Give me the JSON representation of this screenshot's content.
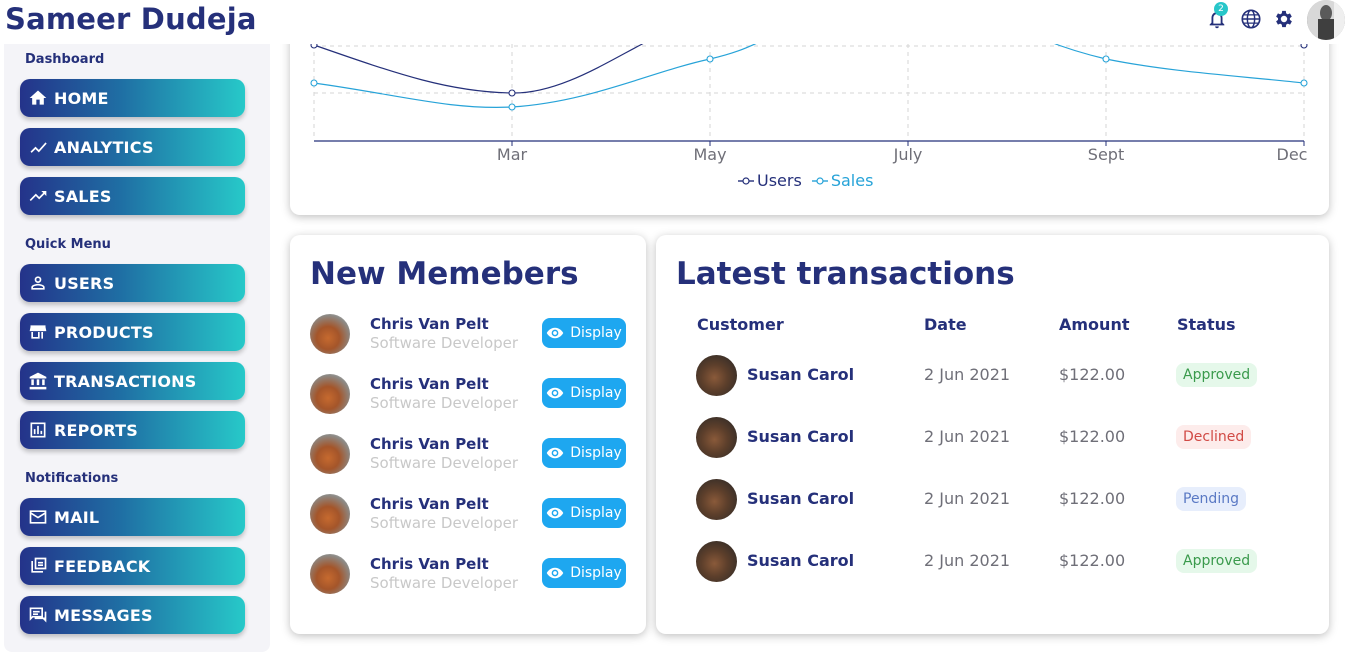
{
  "header": {
    "title": "Sameer Dudeja",
    "notification_count": "2"
  },
  "sidebar": {
    "sections": [
      {
        "title": "Dashboard",
        "items": [
          {
            "label": "HOME",
            "icon": "home-icon"
          },
          {
            "label": "ANALYTICS",
            "icon": "line-chart-icon"
          },
          {
            "label": "SALES",
            "icon": "trending-up-icon"
          }
        ]
      },
      {
        "title": "Quick Menu",
        "items": [
          {
            "label": "USERS",
            "icon": "person-icon"
          },
          {
            "label": "PRODUCTS",
            "icon": "storefront-icon"
          },
          {
            "label": "TRANSACTIONS",
            "icon": "bank-icon"
          },
          {
            "label": "REPORTS",
            "icon": "bar-chart-icon"
          }
        ]
      },
      {
        "title": "Notifications",
        "items": [
          {
            "label": "MAIL",
            "icon": "mail-icon"
          },
          {
            "label": "FEEDBACK",
            "icon": "feedback-icon"
          },
          {
            "label": "MESSAGES",
            "icon": "chat-icon"
          }
        ]
      }
    ]
  },
  "chart_data": {
    "type": "line",
    "x": [
      "Mar",
      "May",
      "July",
      "Sept",
      "Dec"
    ],
    "series": [
      {
        "name": "Users",
        "color": "#25307a"
      },
      {
        "name": "Sales",
        "color": "#27a3d8"
      }
    ],
    "grid": true,
    "legend": "bottom-center"
  },
  "members": {
    "title": "New Memebers",
    "display_label": "Display",
    "items": [
      {
        "name": "Chris Van Pelt",
        "job": "Software Developer"
      },
      {
        "name": "Chris Van Pelt",
        "job": "Software Developer"
      },
      {
        "name": "Chris Van Pelt",
        "job": "Software Developer"
      },
      {
        "name": "Chris Van Pelt",
        "job": "Software Developer"
      },
      {
        "name": "Chris Van Pelt",
        "job": "Software Developer"
      }
    ]
  },
  "transactions": {
    "title": "Latest transactions",
    "columns": [
      "Customer",
      "Date",
      "Amount",
      "Status"
    ],
    "rows": [
      {
        "customer": "Susan Carol",
        "date": "2 Jun 2021",
        "amount": "$122.00",
        "status": "Approved"
      },
      {
        "customer": "Susan Carol",
        "date": "2 Jun 2021",
        "amount": "$122.00",
        "status": "Declined"
      },
      {
        "customer": "Susan Carol",
        "date": "2 Jun 2021",
        "amount": "$122.00",
        "status": "Pending"
      },
      {
        "customer": "Susan Carol",
        "date": "2 Jun 2021",
        "amount": "$122.00",
        "status": "Approved"
      }
    ]
  }
}
